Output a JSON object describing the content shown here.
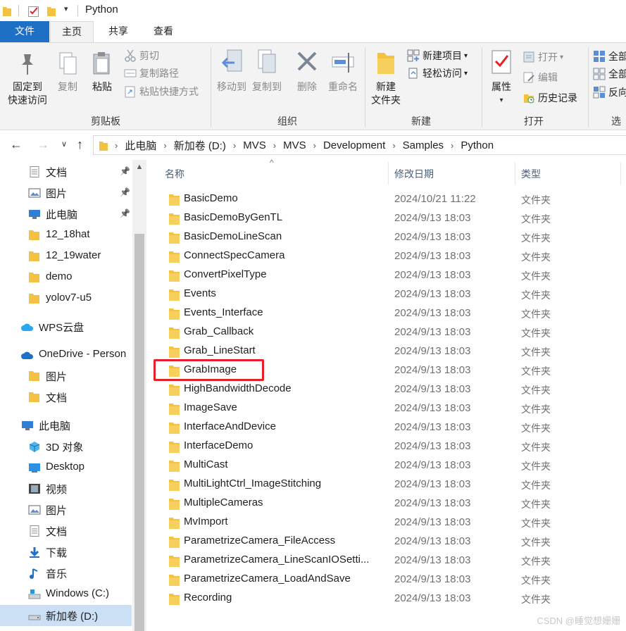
{
  "window": {
    "title": "Python"
  },
  "ribbon_tabs": [
    "文件",
    "主页",
    "共享",
    "查看"
  ],
  "ribbon": {
    "clipboard": {
      "group_label": "剪贴板",
      "pin_quick_access": [
        "固定到",
        "快速访问"
      ],
      "copy": "复制",
      "paste": "粘贴",
      "cut": "剪切",
      "copy_path": "复制路径",
      "paste_shortcut": "粘贴快捷方式"
    },
    "organize": {
      "group_label": "组织",
      "move_to": "移动到",
      "copy_to": "复制到",
      "delete": "删除",
      "rename": "重命名"
    },
    "new": {
      "group_label": "新建",
      "new_folder": [
        "新建",
        "文件夹"
      ],
      "new_item": "新建项目",
      "easy_access": "轻松访问"
    },
    "open": {
      "group_label": "打开",
      "properties": "属性",
      "open": "打开",
      "edit": "编辑",
      "history": "历史记录"
    },
    "select": {
      "group_label": "选",
      "select_all": "全部",
      "select_none": "全部",
      "invert": "反向"
    }
  },
  "address": {
    "crumbs": [
      "此电脑",
      "新加卷 (D:)",
      "MVS",
      "MVS",
      "Development",
      "Samples",
      "Python"
    ]
  },
  "sidebar": {
    "items": [
      {
        "label": "文档",
        "icon": "document-icon",
        "pinned": true
      },
      {
        "label": "图片",
        "icon": "pictures-icon",
        "pinned": true
      },
      {
        "label": "此电脑",
        "icon": "computer-icon",
        "pinned": true
      },
      {
        "label": "12_18hat",
        "icon": "folder-icon",
        "pinned": false
      },
      {
        "label": "12_19water",
        "icon": "folder-icon",
        "pinned": false
      },
      {
        "label": "demo",
        "icon": "folder-icon",
        "pinned": false
      },
      {
        "label": "yolov7-u5",
        "icon": "folder-icon",
        "pinned": false
      },
      {
        "label": "WPS云盘",
        "icon": "cloud-icon",
        "pinned": false
      },
      {
        "label": "OneDrive - Person",
        "icon": "onedrive-icon",
        "pinned": false
      },
      {
        "label": "图片",
        "icon": "folder-icon",
        "pinned": false
      },
      {
        "label": "文档",
        "icon": "folder-icon",
        "pinned": false
      },
      {
        "label": "此电脑",
        "icon": "computer-icon",
        "pinned": false
      },
      {
        "label": "3D 对象",
        "icon": "3d-objects-icon",
        "pinned": false
      },
      {
        "label": "Desktop",
        "icon": "desktop-icon",
        "pinned": false
      },
      {
        "label": "视频",
        "icon": "video-icon",
        "pinned": false
      },
      {
        "label": "图片",
        "icon": "pictures-icon",
        "pinned": false
      },
      {
        "label": "文档",
        "icon": "document-icon",
        "pinned": false
      },
      {
        "label": "下载",
        "icon": "download-icon",
        "pinned": false
      },
      {
        "label": "音乐",
        "icon": "music-icon",
        "pinned": false
      },
      {
        "label": "Windows (C:)",
        "icon": "drive-c-icon",
        "pinned": false
      },
      {
        "label": "新加卷 (D:)",
        "icon": "drive-icon",
        "pinned": false,
        "selected": true
      }
    ]
  },
  "filelist": {
    "columns": {
      "name": "名称",
      "date": "修改日期",
      "type": "类型"
    },
    "rows": [
      {
        "name": "BasicDemo",
        "date": "2024/10/21 11:22",
        "type": "文件夹"
      },
      {
        "name": "BasicDemoByGenTL",
        "date": "2024/9/13 18:03",
        "type": "文件夹"
      },
      {
        "name": "BasicDemoLineScan",
        "date": "2024/9/13 18:03",
        "type": "文件夹"
      },
      {
        "name": "ConnectSpecCamera",
        "date": "2024/9/13 18:03",
        "type": "文件夹"
      },
      {
        "name": "ConvertPixelType",
        "date": "2024/9/13 18:03",
        "type": "文件夹"
      },
      {
        "name": "Events",
        "date": "2024/9/13 18:03",
        "type": "文件夹"
      },
      {
        "name": "Events_Interface",
        "date": "2024/9/13 18:03",
        "type": "文件夹"
      },
      {
        "name": "Grab_Callback",
        "date": "2024/9/13 18:03",
        "type": "文件夹"
      },
      {
        "name": "Grab_LineStart",
        "date": "2024/9/13 18:03",
        "type": "文件夹"
      },
      {
        "name": "GrabImage",
        "date": "2024/9/13 18:03",
        "type": "文件夹",
        "highlighted": true
      },
      {
        "name": "HighBandwidthDecode",
        "date": "2024/9/13 18:03",
        "type": "文件夹"
      },
      {
        "name": "ImageSave",
        "date": "2024/9/13 18:03",
        "type": "文件夹"
      },
      {
        "name": "InterfaceAndDevice",
        "date": "2024/9/13 18:03",
        "type": "文件夹"
      },
      {
        "name": "InterfaceDemo",
        "date": "2024/9/13 18:03",
        "type": "文件夹"
      },
      {
        "name": "MultiCast",
        "date": "2024/9/13 18:03",
        "type": "文件夹"
      },
      {
        "name": "MultiLightCtrl_ImageStitching",
        "date": "2024/9/13 18:03",
        "type": "文件夹"
      },
      {
        "name": "MultipleCameras",
        "date": "2024/9/13 18:03",
        "type": "文件夹"
      },
      {
        "name": "MvImport",
        "date": "2024/9/13 18:03",
        "type": "文件夹"
      },
      {
        "name": "ParametrizeCamera_FileAccess",
        "date": "2024/9/13 18:03",
        "type": "文件夹"
      },
      {
        "name": "ParametrizeCamera_LineScanIOSetti...",
        "date": "2024/9/13 18:03",
        "type": "文件夹"
      },
      {
        "name": "ParametrizeCamera_LoadAndSave",
        "date": "2024/9/13 18:03",
        "type": "文件夹"
      },
      {
        "name": "Recording",
        "date": "2024/9/13 18:03",
        "type": "文件夹"
      }
    ]
  },
  "watermark": "CSDN @睡觉想姗姗",
  "colors": {
    "accent": "#1e6fc6",
    "folder": "#f4c242",
    "highlight_border": "#e5202a",
    "selected_bg": "#cce0f5"
  }
}
